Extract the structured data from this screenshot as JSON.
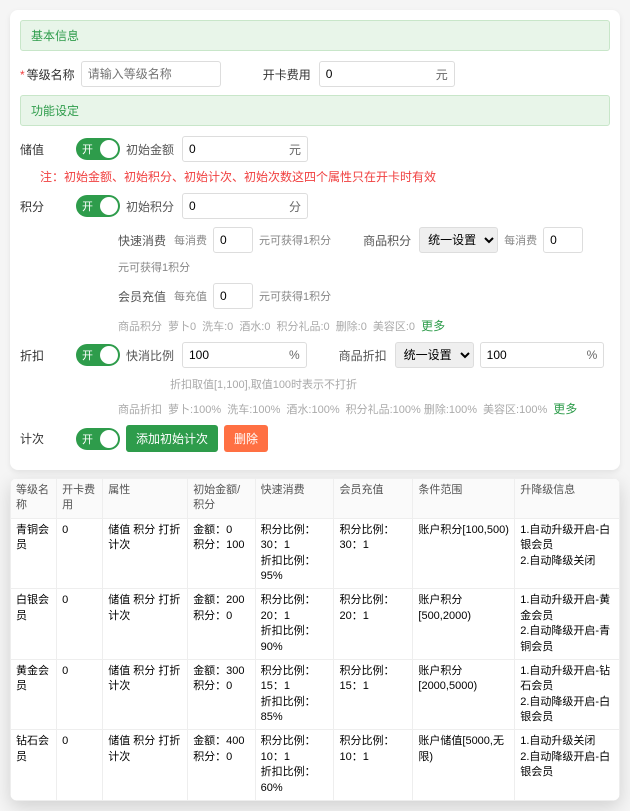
{
  "sections": {
    "basic": "基本信息",
    "func": "功能设定"
  },
  "fields": {
    "levelName": {
      "label": "等级名称",
      "placeholder": "请输入等级名称"
    },
    "cardFee": {
      "label": "开卡费用",
      "value": "0",
      "unit": "元"
    },
    "recharge": {
      "label": "储值",
      "toggle": "开",
      "initLabel": "初始金额",
      "value": "0",
      "unit": "元"
    },
    "points": {
      "label": "积分",
      "toggle": "开",
      "initLabel": "初始积分",
      "value": "0",
      "unit": "分"
    },
    "fastConsume": {
      "label": "快速消费",
      "perLabel": "每消费",
      "perValue": "0",
      "rule": "元可获得1积分"
    },
    "prodPoints": {
      "label": "商品积分",
      "option": "统一设置",
      "perLabel": "每消费",
      "perValue": "0",
      "rule": "元可获得1积分"
    },
    "memberRecharge": {
      "label": "会员充值",
      "perLabel": "每充值",
      "perValue": "0",
      "rule": "元可获得1积分"
    },
    "discount": {
      "label": "折扣",
      "toggle": "开",
      "ratioLabel": "快消比例",
      "value": "100",
      "unit": "%",
      "hint": "折扣取值[1,100],取值100时表示不打折"
    },
    "prodDiscount": {
      "label": "商品折扣",
      "option": "统一设置",
      "value": "100",
      "unit": "%"
    },
    "count": {
      "label": "计次",
      "toggle": "开",
      "addBtn": "添加初始计次",
      "delBtn": "删除"
    }
  },
  "note": "注：初始金额、初始积分、初始计次、初始次数这四个属性只在开卡时有效",
  "grayPoints": {
    "label": "商品积分",
    "items": [
      "萝卜0",
      "洗车:0",
      "酒水:0",
      "积分礼品:0",
      "删除:0",
      "美容区:0"
    ],
    "more": "更多"
  },
  "grayDiscount": {
    "label": "商品折扣",
    "items": [
      "萝卜:100%",
      "洗车:100%",
      "酒水:100%",
      "积分礼品:100% 删除:100%",
      "美容区:100%"
    ],
    "more": "更多"
  },
  "table": {
    "headers": [
      "等级名称",
      "开卡费用",
      "属性",
      "初始金额/积分",
      "快速消费",
      "会员充值",
      "条件范围",
      "升降级信息"
    ],
    "rows": [
      {
        "name": "青铜会员",
        "fee": "0",
        "attr": "储值 积分 打折 计次",
        "init": "金额：0\n积分：100",
        "fast": "积分比例：30：1\n折扣比例：95%",
        "rech": "积分比例：30：1",
        "cond": "账户积分[100,500)",
        "upd": "1.自动升级开启-白银会员\n2.自动降级关闭"
      },
      {
        "name": "白银会员",
        "fee": "0",
        "attr": "储值 积分 打折 计次",
        "init": "金额：200\n积分：0",
        "fast": "积分比例：20：1\n折扣比例：90%",
        "rech": "积分比例：20：1",
        "cond": "账户积分[500,2000)",
        "upd": "1.自动升级开启-黄金会员\n2.自动降级开启-青铜会员"
      },
      {
        "name": "黄金会员",
        "fee": "0",
        "attr": "储值 积分 打折 计次",
        "init": "金额：300\n积分：0",
        "fast": "积分比例：15：1\n折扣比例：85%",
        "rech": "积分比例：15：1",
        "cond": "账户积分[2000,5000)",
        "upd": "1.自动升级开启-钻石会员\n2.自动降级开启-白银会员"
      },
      {
        "name": "钻石会员",
        "fee": "0",
        "attr": "储值 积分 打折 计次",
        "init": "金额：400\n积分：0",
        "fast": "积分比例：10：1\n折扣比例：60%",
        "rech": "积分比例：10：1",
        "cond": "账户储值[5000,无限)",
        "upd": "1.自动升级关闭\n2.自动降级开启-白银会员"
      }
    ]
  }
}
